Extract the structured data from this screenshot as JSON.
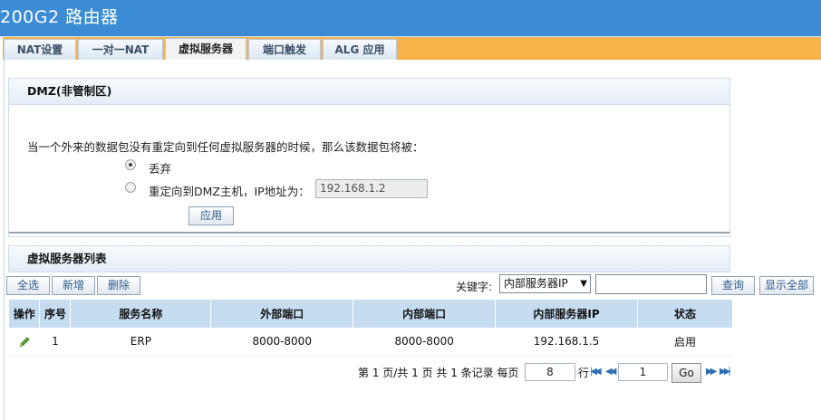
{
  "app": {
    "title": "200G2 路由器"
  },
  "tabs": [
    {
      "label": "NAT设置"
    },
    {
      "label": "一对一NAT"
    },
    {
      "label": "虚拟服务器"
    },
    {
      "label": "端口触发"
    },
    {
      "label": "ALG 应用"
    }
  ],
  "dmz": {
    "heading": "DMZ(非管制区)",
    "description": "当一个外来的数据包没有重定向到任何虚拟服务器的时候，那么该数据包将被：",
    "option_discard": "丢弃",
    "option_redirect": "重定向到DMZ主机，IP地址为：",
    "ip_value": "192.168.1.2",
    "apply_label": "应用",
    "selected_option": "丢弃"
  },
  "list": {
    "heading": "虚拟服务器列表",
    "select_all": "全选",
    "add": "新增",
    "delete": "删除",
    "keyword_label": "关键字:",
    "keyword_select": "内部服务器IP",
    "keyword_value": "",
    "search_label": "查询",
    "show_all_label": "显示全部",
    "columns": [
      "操作",
      "序号",
      "服务名称",
      "外部端口",
      "内部端口",
      "内部服务器IP",
      "状态"
    ],
    "rows": [
      {
        "index": "1",
        "name": "ERP",
        "ext_port": "8000-8000",
        "int_port": "8000-8000",
        "ip": "192.168.1.5",
        "status": "启用"
      }
    ]
  },
  "pager": {
    "summary": "第 1 页/共 1 页 共 1 条记录 每页",
    "per_page": "8",
    "row_unit": "行",
    "current_page": "1",
    "go_label": "Go"
  },
  "colors": {
    "title_bar": "#3b8cd4",
    "tab_bar": "#f7b34a",
    "header_row": "#c6dcf0",
    "edit_icon": "#3a8a2a"
  }
}
